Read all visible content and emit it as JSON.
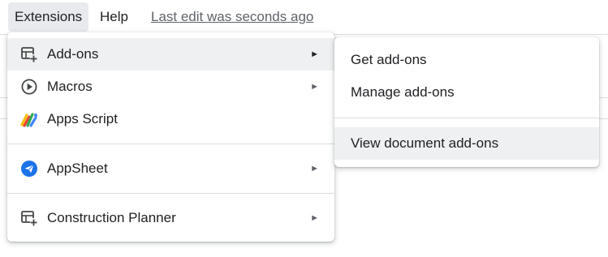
{
  "menubar": {
    "extensions_label": "Extensions",
    "help_label": "Help",
    "last_edit": "Last edit was seconds ago"
  },
  "extensions_menu": {
    "items": [
      {
        "label": "Add-ons",
        "icon": "add-ons-table-icon",
        "has_submenu": true,
        "highlighted": true
      },
      {
        "label": "Macros",
        "icon": "play-circle-icon",
        "has_submenu": true
      },
      {
        "label": "Apps Script",
        "icon": "apps-script-icon",
        "has_submenu": false
      },
      {
        "label": "AppSheet",
        "icon": "appsheet-icon",
        "has_submenu": true
      },
      {
        "label": "Construction Planner",
        "icon": "add-ons-table-icon",
        "has_submenu": true
      }
    ],
    "submenu_arrow": "►"
  },
  "addons_submenu": {
    "items": [
      {
        "label": "Get add-ons"
      },
      {
        "label": "Manage add-ons"
      },
      {
        "label": "View document add-ons",
        "highlighted": true
      }
    ]
  },
  "colors": {
    "menubar_active_bg": "#e8eaed",
    "row_hover_bg": "#eef0f1",
    "appsheet_blue": "#1a73e8",
    "text": "#202124",
    "secondary_text": "#5f6368"
  }
}
